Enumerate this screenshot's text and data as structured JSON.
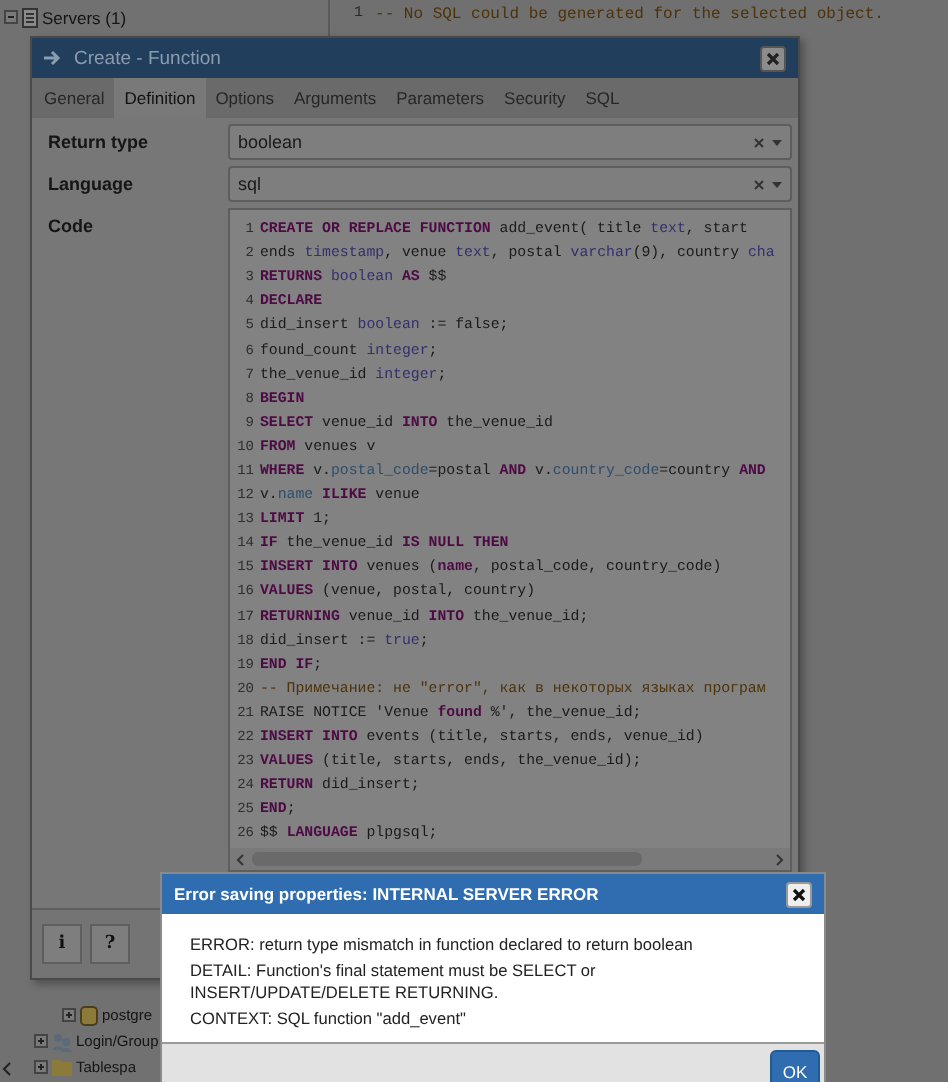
{
  "background": {
    "tree_top": [
      {
        "label": "Servers (1)",
        "expanded": true
      }
    ],
    "sql_panel": {
      "line_number": "1",
      "text": "-- No SQL could be generated for the selected object."
    },
    "tree_bottom": [
      {
        "label": "postgre",
        "expanded": false
      },
      {
        "label": "Login/Group",
        "expanded": false
      },
      {
        "label": "Tablespa",
        "expanded": false
      }
    ]
  },
  "function_dialog": {
    "title": "Create - Function",
    "tabs": [
      {
        "label": "General",
        "selected": false
      },
      {
        "label": "Definition",
        "selected": true
      },
      {
        "label": "Options",
        "selected": false
      },
      {
        "label": "Arguments",
        "selected": false
      },
      {
        "label": "Parameters",
        "selected": false
      },
      {
        "label": "Security",
        "selected": false
      },
      {
        "label": "SQL",
        "selected": false
      }
    ],
    "fields": [
      {
        "label": "Return type",
        "value": "boolean"
      },
      {
        "label": "Language",
        "value": "sql"
      }
    ],
    "code": {
      "label": "Code",
      "lines": [
        {
          "number": "1",
          "tokens": [
            {
              "kind": "kw",
              "text": "CREATE OR REPLACE FUNCTION"
            },
            {
              "kind": "plain",
              "text": " add_event( title "
            },
            {
              "kind": "type",
              "text": "text"
            },
            {
              "kind": "plain",
              "text": ", start"
            }
          ]
        },
        {
          "number": "2",
          "tokens": [
            {
              "kind": "plain",
              "text": "ends "
            },
            {
              "kind": "type",
              "text": "timestamp"
            },
            {
              "kind": "plain",
              "text": ", venue "
            },
            {
              "kind": "type",
              "text": "text"
            },
            {
              "kind": "plain",
              "text": ", postal "
            },
            {
              "kind": "type",
              "text": "varchar"
            },
            {
              "kind": "plain",
              "text": "(9), country "
            },
            {
              "kind": "type",
              "text": "cha"
            }
          ]
        },
        {
          "number": "3",
          "tokens": [
            {
              "kind": "kw",
              "text": "RETURNS"
            },
            {
              "kind": "type",
              "text": " boolean "
            },
            {
              "kind": "kw",
              "text": "AS"
            },
            {
              "kind": "plain",
              "text": " $$"
            }
          ]
        },
        {
          "number": "4",
          "tokens": [
            {
              "kind": "kw",
              "text": "DECLARE"
            }
          ]
        },
        {
          "number": "5",
          "tokens": [
            {
              "kind": "plain",
              "text": "did_insert "
            },
            {
              "kind": "type",
              "text": "boolean"
            },
            {
              "kind": "plain",
              "text": " := false;"
            }
          ]
        },
        {
          "number": "6",
          "tokens": [
            {
              "kind": "plain",
              "text": "found_count "
            },
            {
              "kind": "type",
              "text": "integer"
            },
            {
              "kind": "plain",
              "text": ";"
            }
          ]
        },
        {
          "number": "7",
          "tokens": [
            {
              "kind": "plain",
              "text": "the_venue_id "
            },
            {
              "kind": "type",
              "text": "integer"
            },
            {
              "kind": "plain",
              "text": ";"
            }
          ]
        },
        {
          "number": "8",
          "tokens": [
            {
              "kind": "kw",
              "text": "BEGIN"
            }
          ]
        },
        {
          "number": "9",
          "tokens": [
            {
              "kind": "kw",
              "text": "SELECT"
            },
            {
              "kind": "plain",
              "text": " venue_id "
            },
            {
              "kind": "kw",
              "text": "INTO"
            },
            {
              "kind": "plain",
              "text": " the_venue_id"
            }
          ]
        },
        {
          "number": "10",
          "tokens": [
            {
              "kind": "kw",
              "text": "FROM"
            },
            {
              "kind": "plain",
              "text": " venues v"
            }
          ]
        },
        {
          "number": "11",
          "tokens": [
            {
              "kind": "kw",
              "text": "WHERE"
            },
            {
              "kind": "plain",
              "text": " v."
            },
            {
              "kind": "prop",
              "text": "postal_code"
            },
            {
              "kind": "plain",
              "text": "=postal "
            },
            {
              "kind": "kw",
              "text": "AND"
            },
            {
              "kind": "plain",
              "text": " v."
            },
            {
              "kind": "prop",
              "text": "country_code"
            },
            {
              "kind": "plain",
              "text": "=country "
            },
            {
              "kind": "kw",
              "text": "AND"
            }
          ]
        },
        {
          "number": "12",
          "tokens": [
            {
              "kind": "plain",
              "text": "v."
            },
            {
              "kind": "prop",
              "text": "name"
            },
            {
              "kind": "kw",
              "text": " ILIKE"
            },
            {
              "kind": "plain",
              "text": " venue"
            }
          ]
        },
        {
          "number": "13",
          "tokens": [
            {
              "kind": "kw",
              "text": "LIMIT"
            },
            {
              "kind": "plain",
              "text": " 1;"
            }
          ]
        },
        {
          "number": "14",
          "tokens": [
            {
              "kind": "kw",
              "text": "IF"
            },
            {
              "kind": "plain",
              "text": " the_venue_id "
            },
            {
              "kind": "kw",
              "text": "IS NULL THEN"
            }
          ]
        },
        {
          "number": "15",
          "tokens": [
            {
              "kind": "kw",
              "text": "INSERT INTO"
            },
            {
              "kind": "plain",
              "text": " venues ("
            },
            {
              "kind": "kw",
              "text": "name"
            },
            {
              "kind": "plain",
              "text": ", postal_code, country_code)"
            }
          ]
        },
        {
          "number": "16",
          "tokens": [
            {
              "kind": "kw",
              "text": "VALUES"
            },
            {
              "kind": "plain",
              "text": " (venue, postal, country)"
            }
          ]
        },
        {
          "number": "17",
          "tokens": [
            {
              "kind": "kw",
              "text": "RETURNING"
            },
            {
              "kind": "plain",
              "text": " venue_id "
            },
            {
              "kind": "kw",
              "text": "INTO"
            },
            {
              "kind": "plain",
              "text": " the_venue_id;"
            }
          ]
        },
        {
          "number": "18",
          "tokens": [
            {
              "kind": "plain",
              "text": "did_insert := "
            },
            {
              "kind": "type",
              "text": "true"
            },
            {
              "kind": "plain",
              "text": ";"
            }
          ]
        },
        {
          "number": "19",
          "tokens": [
            {
              "kind": "kw",
              "text": "END IF"
            },
            {
              "kind": "plain",
              "text": ";"
            }
          ]
        },
        {
          "number": "20",
          "tokens": [
            {
              "kind": "comment",
              "text": "-- Примечание: не \"error\", как в некоторых языках програм"
            }
          ]
        },
        {
          "number": "21",
          "tokens": [
            {
              "kind": "plain",
              "text": "RAISE NOTICE 'Venue "
            },
            {
              "kind": "kw",
              "text": "found"
            },
            {
              "kind": "plain",
              "text": " %', the_venue_id;"
            }
          ]
        },
        {
          "number": "22",
          "tokens": [
            {
              "kind": "kw",
              "text": "INSERT INTO"
            },
            {
              "kind": "plain",
              "text": " events (title, starts, ends, venue_id)"
            }
          ]
        },
        {
          "number": "23",
          "tokens": [
            {
              "kind": "kw",
              "text": "VALUES"
            },
            {
              "kind": "plain",
              "text": " (title, starts, ends, the_venue_id);"
            }
          ]
        },
        {
          "number": "24",
          "tokens": [
            {
              "kind": "kw",
              "text": "RETURN"
            },
            {
              "kind": "plain",
              "text": " did_insert;"
            }
          ]
        },
        {
          "number": "25",
          "tokens": [
            {
              "kind": "kw",
              "text": "END"
            },
            {
              "kind": "plain",
              "text": ";"
            }
          ]
        },
        {
          "number": "26",
          "tokens": [
            {
              "kind": "plain",
              "text": "$$ "
            },
            {
              "kind": "kw",
              "text": "LANGUAGE"
            },
            {
              "kind": "plain",
              "text": " plpgsql;"
            }
          ]
        }
      ]
    },
    "footer_buttons": [
      "i",
      "?"
    ]
  },
  "error_dialog": {
    "title": "Error saving properties: INTERNAL SERVER ERROR",
    "lines": [
      "ERROR: return type mismatch in function declared to return boolean",
      "DETAIL: Function's final statement must be SELECT or INSERT/UPDATE/DELETE RETURNING.",
      "CONTEXT: SQL function \"add_event\""
    ],
    "button": "OK"
  }
}
